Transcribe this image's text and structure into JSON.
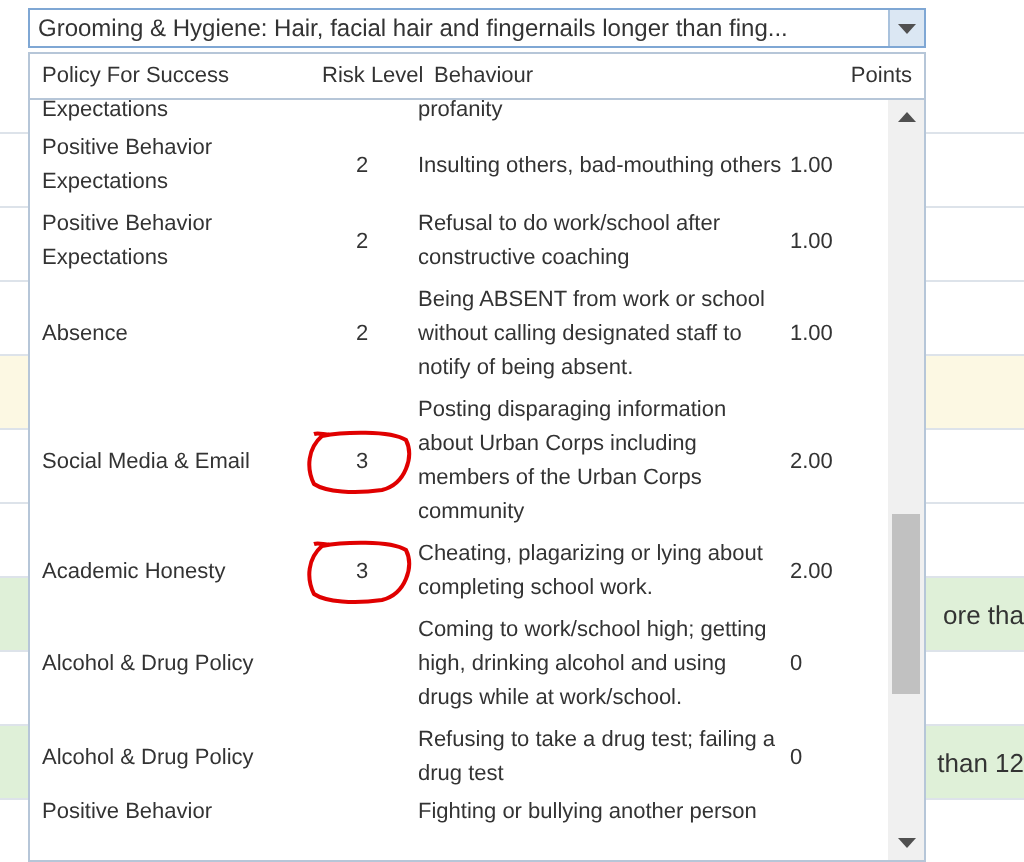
{
  "background_rows": [
    {
      "kind": "plain",
      "text": ""
    },
    {
      "kind": "plain",
      "text": ""
    },
    {
      "kind": "plain",
      "text": ""
    },
    {
      "kind": "plain",
      "text": ""
    },
    {
      "kind": "warning",
      "text": ""
    },
    {
      "kind": "plain",
      "text": ""
    },
    {
      "kind": "plain",
      "text": ""
    },
    {
      "kind": "success",
      "text": "ore tha"
    },
    {
      "kind": "plain",
      "text": ""
    },
    {
      "kind": "success",
      "text": "than 12"
    },
    {
      "kind": "plain",
      "text": ""
    }
  ],
  "dropdown": {
    "value": "Grooming & Hygiene: Hair, facial hair and fingernails longer than fing...",
    "columns": [
      "Policy For Success",
      "Risk Level",
      "Behaviour",
      "Points"
    ],
    "rows": [
      {
        "policy": "Expectations",
        "risk": "",
        "behaviour": "profanity",
        "points": "",
        "annotated": false,
        "kind": "partial"
      },
      {
        "policy": "Positive Behavior Expectations",
        "risk": "2",
        "behaviour": "Insulting others, bad-mouthing others",
        "points": "1.00",
        "annotated": false,
        "kind": "full"
      },
      {
        "policy": "Positive Behavior Expectations",
        "risk": "2",
        "behaviour": "Refusal to do work/school after constructive coaching",
        "points": "1.00",
        "annotated": false,
        "kind": "full"
      },
      {
        "policy": "Absence",
        "risk": "2",
        "behaviour": "Being ABSENT from work or school without calling designated staff to notify of being absent.",
        "points": "1.00",
        "annotated": false,
        "kind": "full"
      },
      {
        "policy": "Social Media & Email",
        "risk": "3",
        "behaviour": "Posting disparaging information about Urban Corps including members of the Urban Corps community",
        "points": "2.00",
        "annotated": true,
        "kind": "full"
      },
      {
        "policy": "Academic Honesty",
        "risk": "3",
        "behaviour": "Cheating, plagarizing or lying about completing school work.",
        "points": "2.00",
        "annotated": true,
        "kind": "full"
      },
      {
        "policy": "Alcohol & Drug Policy",
        "risk": "",
        "behaviour": "Coming to work/school high; getting high, drinking alcohol and using drugs while at work/school.",
        "points": "0",
        "annotated": false,
        "kind": "full"
      },
      {
        "policy": "Alcohol & Drug Policy",
        "risk": "",
        "behaviour": "Refusing to take a drug test; failing a drug test",
        "points": "0",
        "annotated": false,
        "kind": "full"
      },
      {
        "policy": "Positive Behavior",
        "risk": "",
        "behaviour": "Fighting or bullying another person",
        "points": "",
        "annotated": false,
        "kind": "partial"
      }
    ]
  }
}
